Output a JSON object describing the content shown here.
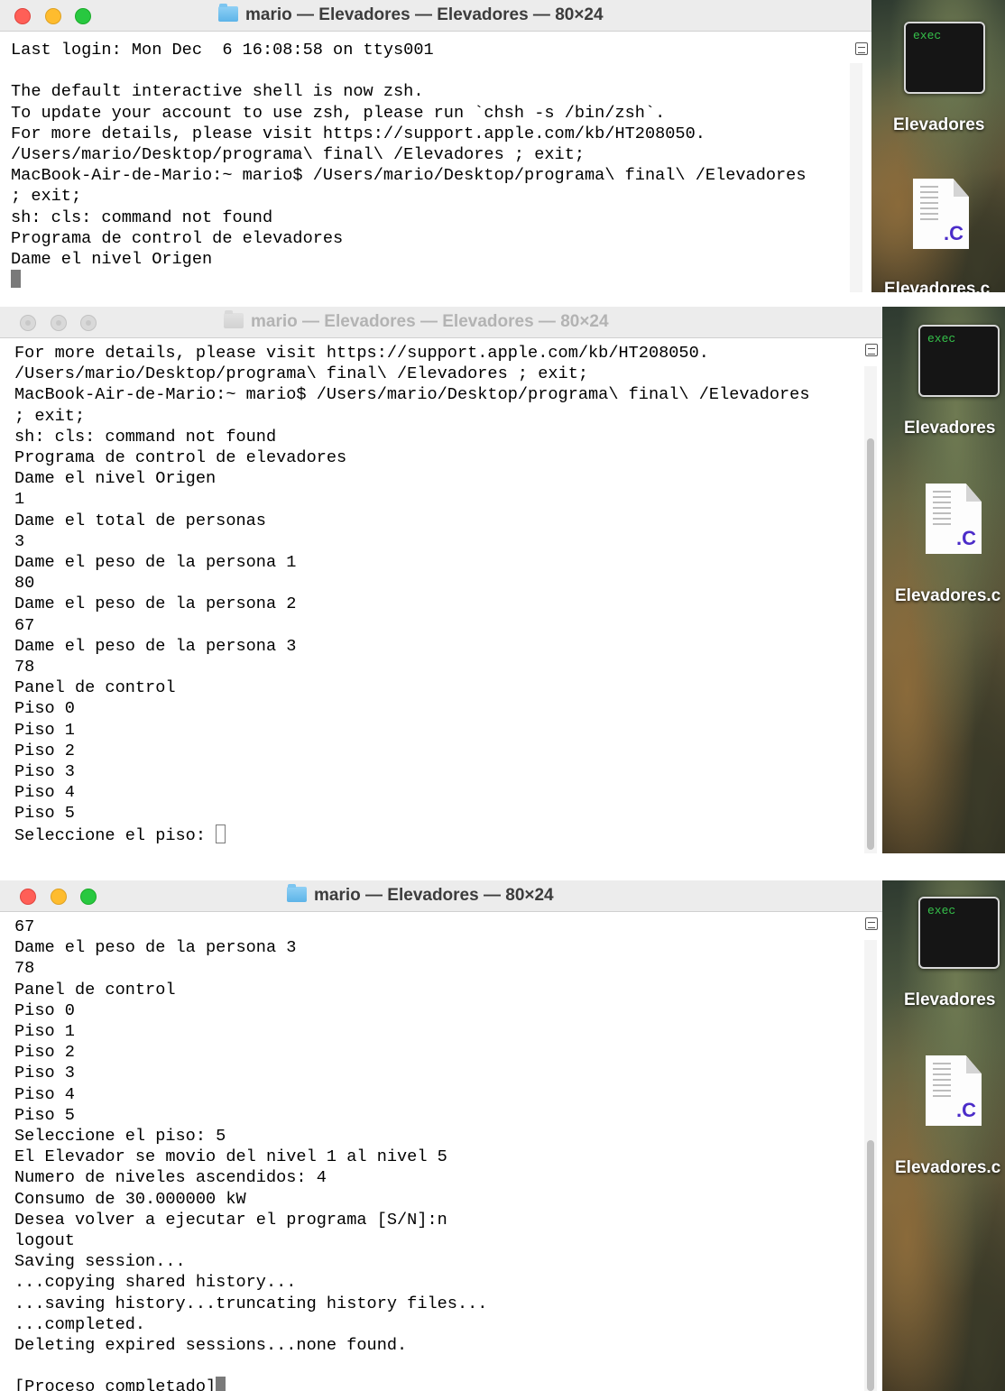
{
  "desktop": {
    "exec_label": "exec",
    "folder_label": "Elevadores",
    "file_ext": ".C",
    "file_label_1": "Elevadores.c",
    "file_label_2": "Elevadores.c",
    "file_label_3": "Elevadores.c"
  },
  "window1": {
    "title": "mario — Elevadores — Elevadores — 80×24",
    "text": "Last login: Mon Dec  6 16:08:58 on ttys001\n\nThe default interactive shell is now zsh.\nTo update your account to use zsh, please run `chsh -s /bin/zsh`.\nFor more details, please visit https://support.apple.com/kb/HT208050.\n/Users/mario/Desktop/programa\\ final\\ /Elevadores ; exit;\nMacBook-Air-de-Mario:~ mario$ /Users/mario/Desktop/programa\\ final\\ /Elevadores\n; exit;\nsh: cls: command not found\nPrograma de control de elevadores\nDame el nivel Origen\n"
  },
  "window2": {
    "title": "mario — Elevadores — Elevadores — 80×24",
    "text": "For more details, please visit https://support.apple.com/kb/HT208050.\n/Users/mario/Desktop/programa\\ final\\ /Elevadores ; exit;\nMacBook-Air-de-Mario:~ mario$ /Users/mario/Desktop/programa\\ final\\ /Elevadores\n; exit;\nsh: cls: command not found\nPrograma de control de elevadores\nDame el nivel Origen\n1\nDame el total de personas\n3\nDame el peso de la persona 1\n80\nDame el peso de la persona 2\n67\nDame el peso de la persona 3\n78\nPanel de control\nPiso 0\nPiso 1\nPiso 2\nPiso 3\nPiso 4\nPiso 5\nSeleccione el piso: "
  },
  "window3": {
    "title": "mario — Elevadores — 80×24",
    "text": "67\nDame el peso de la persona 3\n78\nPanel de control\nPiso 0\nPiso 1\nPiso 2\nPiso 3\nPiso 4\nPiso 5\nSeleccione el piso: 5\nEl Elevador se movio del nivel 1 al nivel 5\nNumero de niveles ascendidos: 4\nConsumo de 30.000000 kW\nDesea volver a ejecutar el programa [S/N]:n\nlogout\nSaving session...\n...copying shared history...\n...saving history...truncating history files...\n...completed.\nDeleting expired sessions...none found.\n\n[Proceso completado]"
  }
}
